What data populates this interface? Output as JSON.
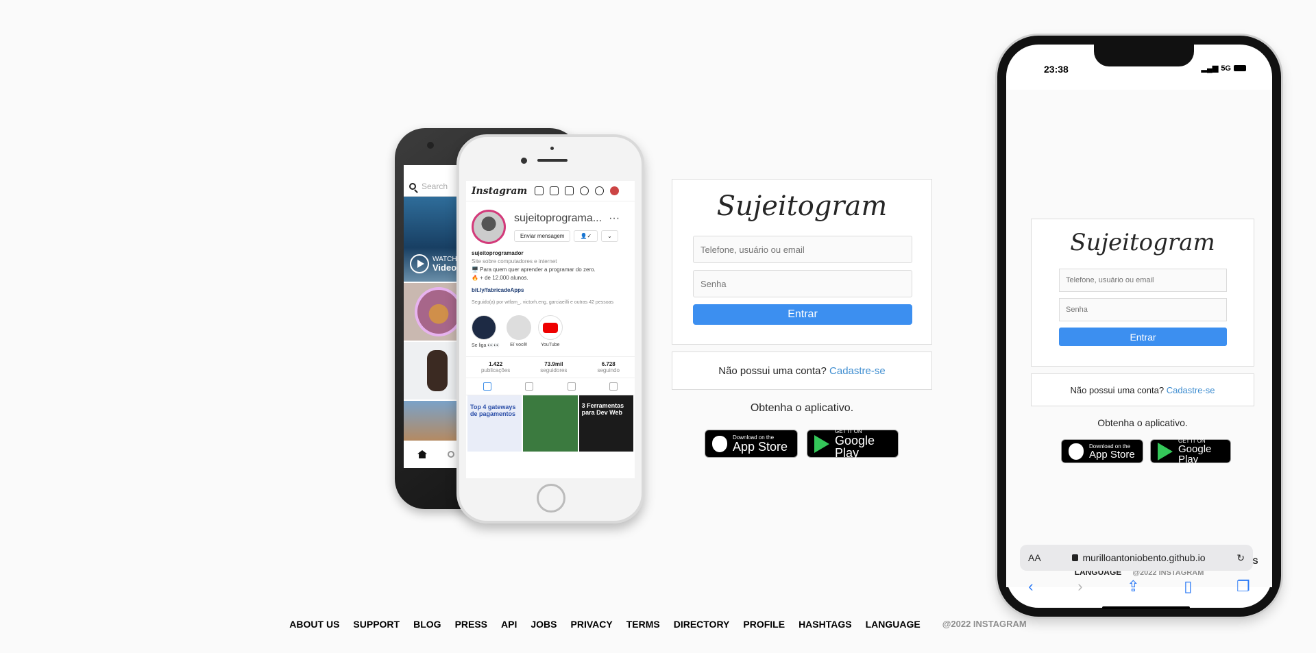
{
  "login": {
    "logo": "Sujeitogram",
    "username_placeholder": "Telefone, usuário ou email",
    "password_placeholder": "Senha",
    "login_button": "Entrar"
  },
  "signup": {
    "prompt": "Não possui uma conta?",
    "link": "Cadastre-se"
  },
  "get_app": {
    "text": "Obtenha o aplicativo.",
    "appstore_small": "Download on the",
    "appstore_large": "App Store",
    "googleplay_small": "GET IT ON",
    "googleplay_large": "Google Play"
  },
  "footer": {
    "links": [
      "ABOUT US",
      "SUPPORT",
      "BLOG",
      "PRESS",
      "API",
      "JOBS",
      "PRIVACY",
      "TERMS",
      "DIRECTORY",
      "PROFILE",
      "HASHTAGS",
      "LANGUAGE"
    ],
    "copyright": "@2022 INSTAGRAM"
  },
  "left_phone": {
    "search_placeholder": "Search",
    "watch_small": "WATCH",
    "watch_large": "Video",
    "app_logo": "Instagram",
    "username": "sujeitoprograma...",
    "message_button": "Enviar mensagem",
    "bio_name": "sujeitoprogramador",
    "bio_category": "Site sobre computadores e internet",
    "bio_line1": "🖥️ Para quem quer aprender a programar do zero.",
    "bio_line2": "🔥 + de 12.000 alunos.",
    "bio_link": "bit.ly/fabricadeApps",
    "followed_by": "Seguido(a) por wtfam_, victorh.eng, garciaeilli e outras 42 pessoas",
    "highlights": [
      "Se liga 👀👀",
      "Eí você!",
      "YouTube"
    ],
    "stats": [
      {
        "value": "1.422",
        "label": "publicações"
      },
      {
        "value": "73.9mil",
        "label": "seguidores"
      },
      {
        "value": "6.728",
        "label": "seguindo"
      }
    ],
    "post1_text": "Top 4 gateways de pagamentos",
    "post3_text": "3 Ferramentas para Dev Web"
  },
  "right_phone": {
    "time": "23:38",
    "network": "5G",
    "url": "murilloantoniobento.github.io",
    "text_size": "AA"
  }
}
